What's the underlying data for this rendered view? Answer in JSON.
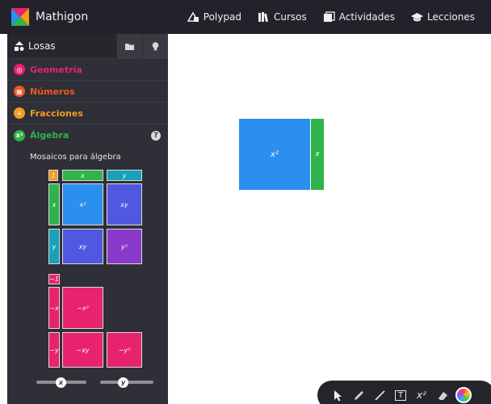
{
  "app": {
    "name": "Mathigon",
    "nav": [
      {
        "label": "Polypad",
        "icon": "polypad-icon"
      },
      {
        "label": "Cursos",
        "icon": "cursos-icon"
      },
      {
        "label": "Actividades",
        "icon": "actividades-icon"
      },
      {
        "label": "Lecciones",
        "icon": "lecciones-icon"
      }
    ]
  },
  "sidebar": {
    "panel_title": "Losas",
    "categories": [
      {
        "label": "Geometría",
        "color": "#e7236d",
        "icon": "geometry-icon"
      },
      {
        "label": "Números",
        "color": "#f0561f",
        "icon": "numbers-icon"
      },
      {
        "label": "Fracciones",
        "color": "#f39c1f",
        "icon": "fractions-icon"
      },
      {
        "label": "Álgebra",
        "color": "#2fb34a",
        "icon": "algebra-icon",
        "badge": "x²"
      }
    ],
    "help": "?",
    "subsection_title": "Mosaicos para álgebra",
    "tiles": {
      "one": "1",
      "x_top": "x",
      "y_top": "y",
      "x_left": "x",
      "y_left": "y",
      "x2": "x²",
      "xy_a": "xy",
      "xy_b": "xy",
      "y2": "y²",
      "neg_one": "−1",
      "neg_x": "−x",
      "neg_y": "−y",
      "neg_x2": "−x²",
      "neg_xy": "−xy",
      "neg_y2": "−y²"
    },
    "sliders": [
      {
        "label": "x"
      },
      {
        "label": "y"
      }
    ]
  },
  "canvas": {
    "x2_tile": "x²",
    "x_tile": "x"
  },
  "toolbar": {
    "text_tool": "T",
    "power_tool": "x²"
  },
  "colors": {
    "accent_blue": "#2b8ff0",
    "accent_green": "#2fb34a",
    "accent_pink": "#e7236d",
    "dark_bar": "#22222b"
  }
}
